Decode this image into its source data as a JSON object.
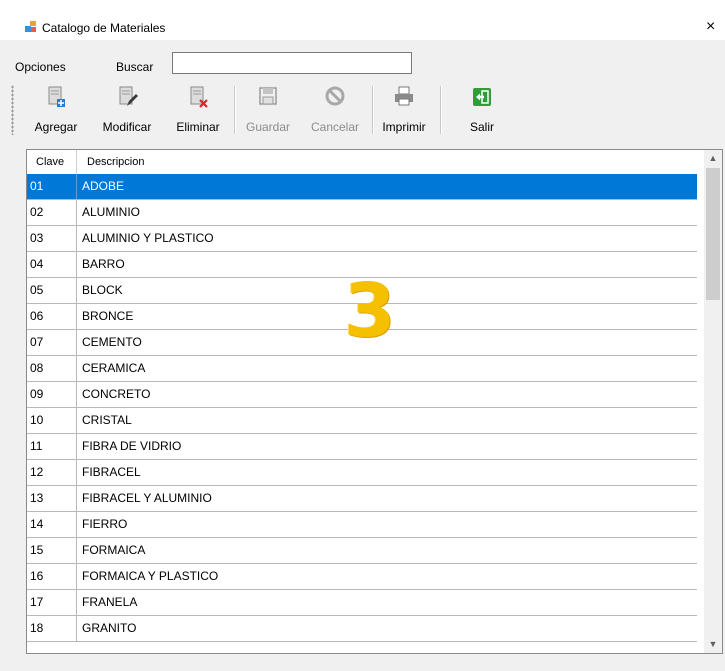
{
  "window": {
    "title": "Catalogo de Materiales",
    "close_glyph": "×"
  },
  "menu": {
    "opciones": "Opciones",
    "buscar": "Buscar",
    "search_value": ""
  },
  "toolbar": {
    "agregar": "Agregar",
    "modificar": "Modificar",
    "eliminar": "Eliminar",
    "guardar": "Guardar",
    "cancelar": "Cancelar",
    "imprimir": "Imprimir",
    "salir": "Salir"
  },
  "grid": {
    "columns": [
      "Clave",
      "Descripcion"
    ],
    "selected_index": 0,
    "rows": [
      {
        "clave": "01",
        "descripcion": "ADOBE"
      },
      {
        "clave": "02",
        "descripcion": "ALUMINIO"
      },
      {
        "clave": "03",
        "descripcion": "ALUMINIO  Y PLASTICO"
      },
      {
        "clave": "04",
        "descripcion": "BARRO"
      },
      {
        "clave": "05",
        "descripcion": "BLOCK"
      },
      {
        "clave": "06",
        "descripcion": "BRONCE"
      },
      {
        "clave": "07",
        "descripcion": "CEMENTO"
      },
      {
        "clave": "08",
        "descripcion": "CERAMICA"
      },
      {
        "clave": "09",
        "descripcion": "CONCRETO"
      },
      {
        "clave": "10",
        "descripcion": "CRISTAL"
      },
      {
        "clave": "11",
        "descripcion": "FIBRA DE VIDRIO"
      },
      {
        "clave": "12",
        "descripcion": "FIBRACEL"
      },
      {
        "clave": "13",
        "descripcion": "FIBRACEL Y ALUMINIO"
      },
      {
        "clave": "14",
        "descripcion": "FIERRO"
      },
      {
        "clave": "15",
        "descripcion": "FORMAICA"
      },
      {
        "clave": "16",
        "descripcion": "FORMAICA Y PLASTICO"
      },
      {
        "clave": "17",
        "descripcion": "FRANELA"
      },
      {
        "clave": "18",
        "descripcion": "GRANITO"
      }
    ]
  },
  "overlay_label": "3",
  "colors": {
    "selection": "#0078d7",
    "overlay": "#f5c000"
  }
}
